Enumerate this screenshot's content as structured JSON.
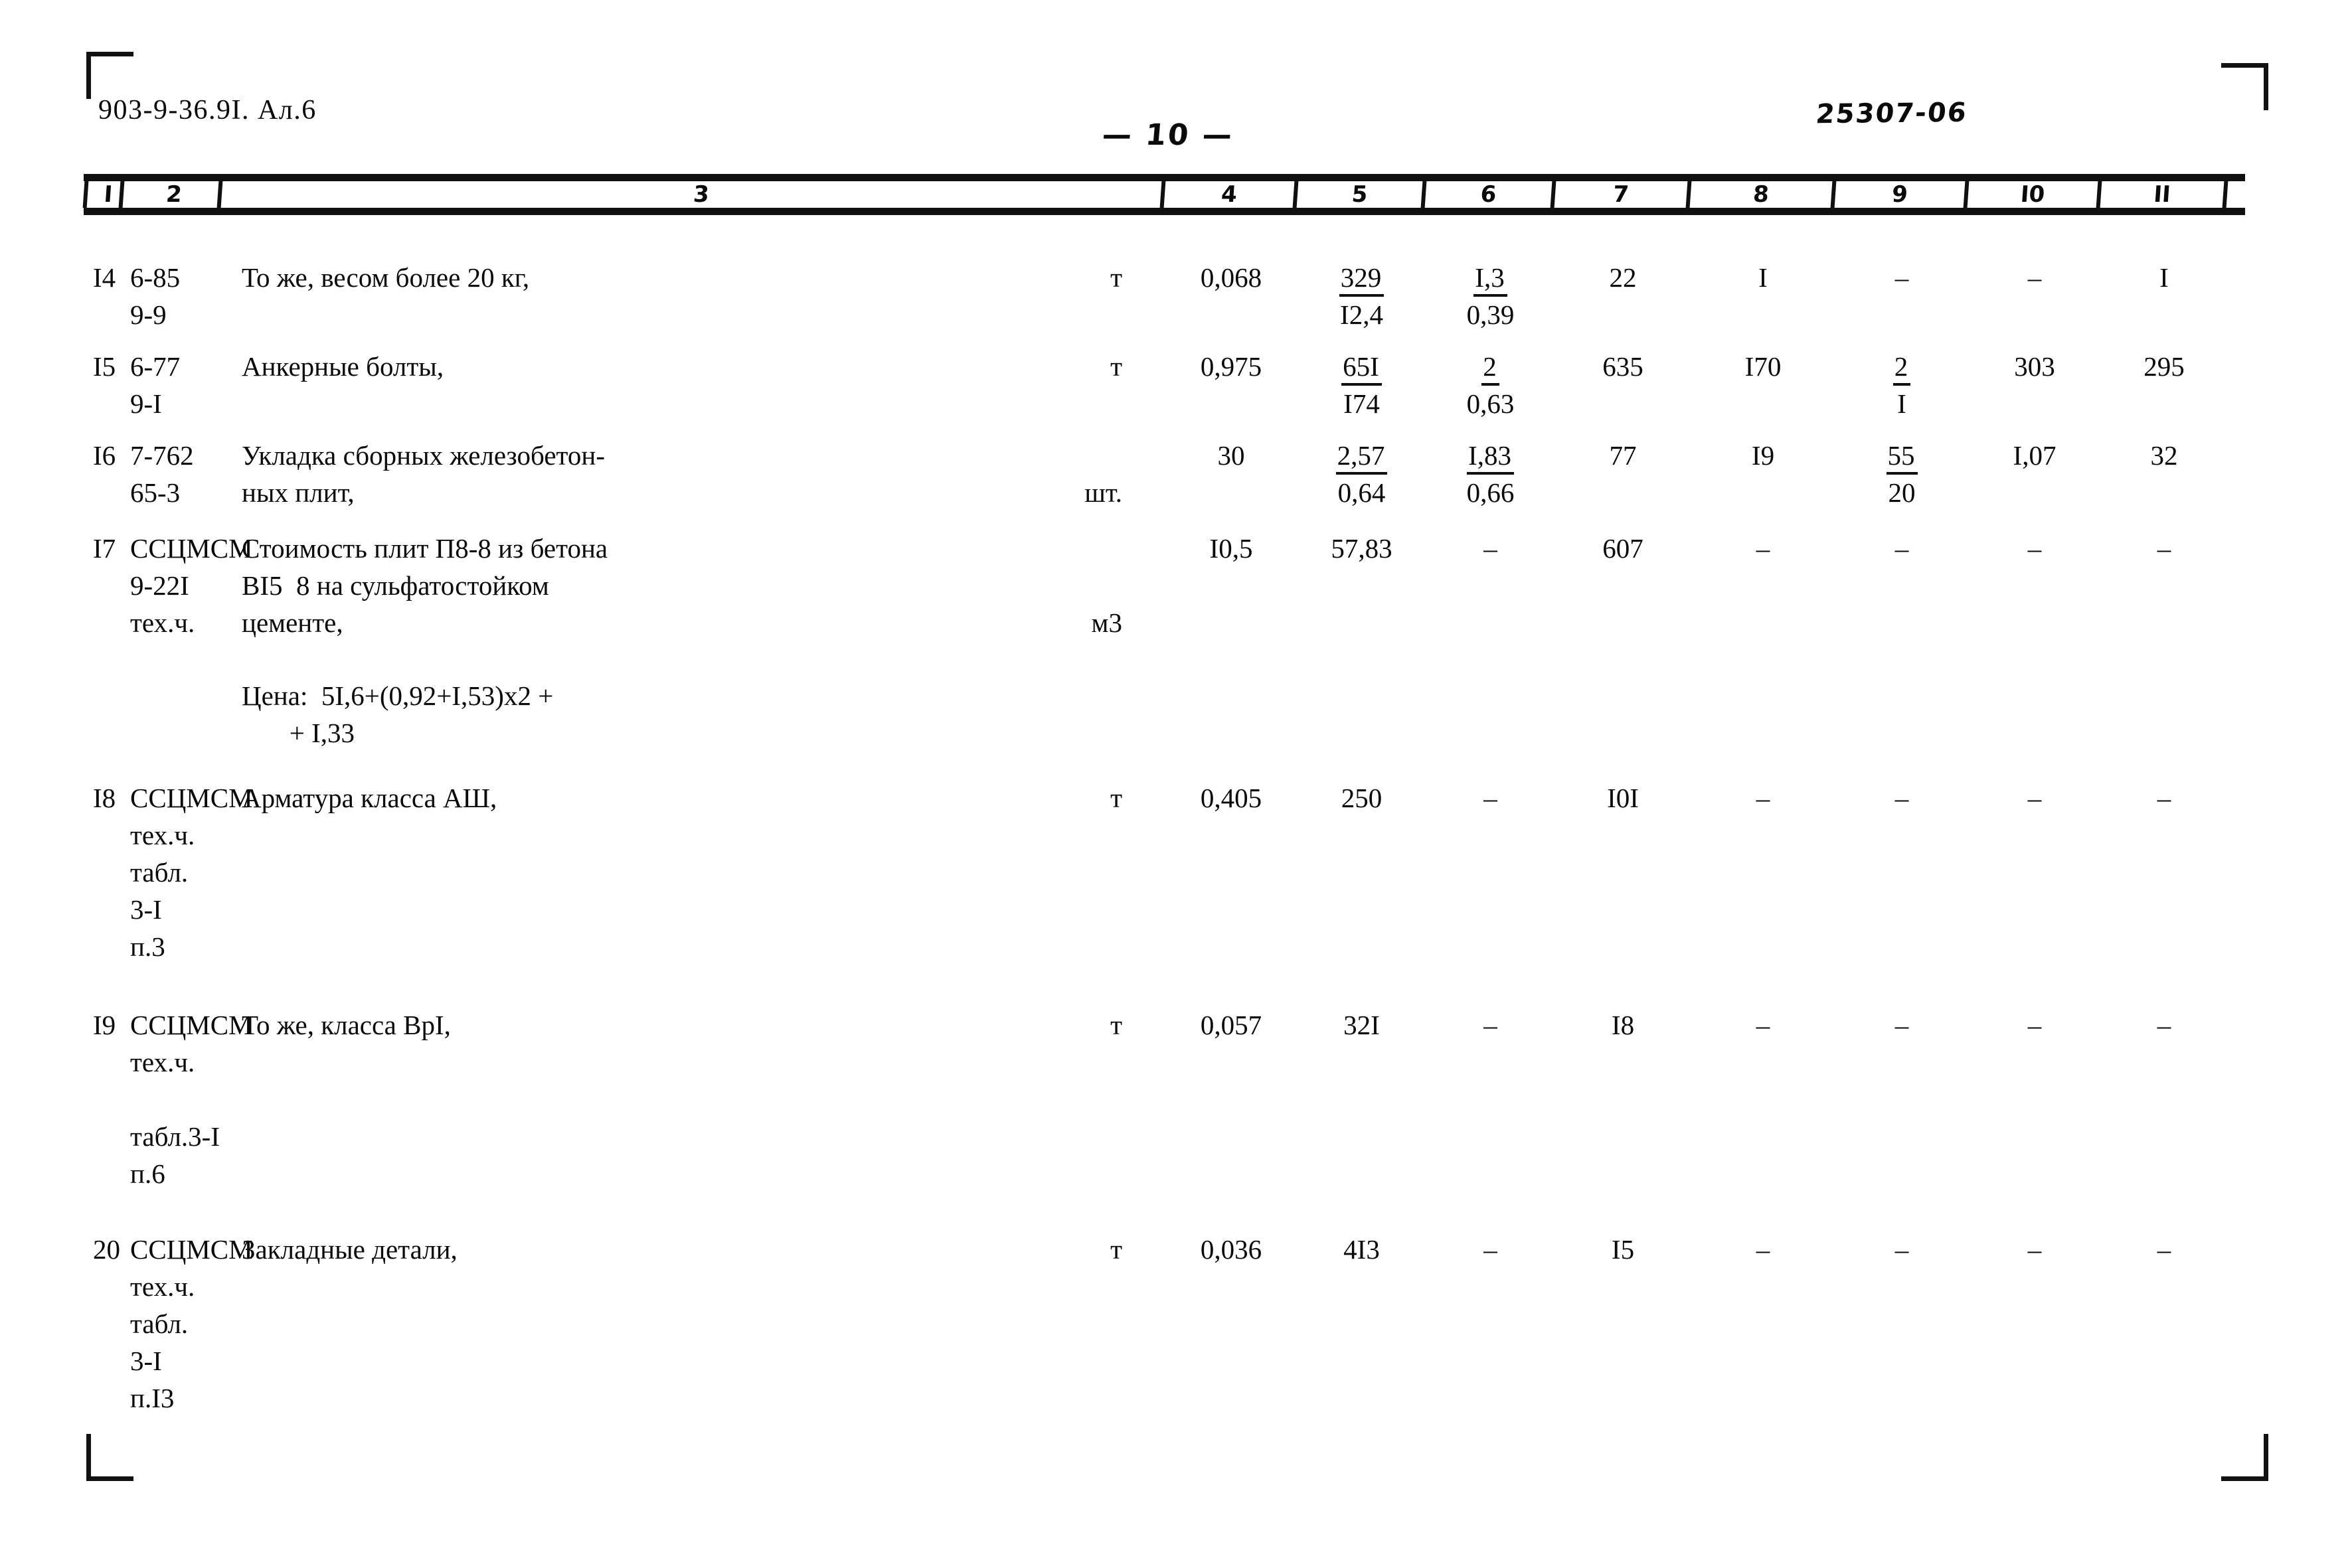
{
  "header": {
    "doc_code": "903-9-36.9I. Ал.6",
    "page_number": "— 10 —",
    "stamp_code": "25307-06"
  },
  "table": {
    "column_headers": [
      "I",
      "2",
      "3",
      "4",
      "5",
      "6",
      "7",
      "8",
      "9",
      "I0",
      "II"
    ],
    "rows": [
      {
        "c1": "I4",
        "c2": "6-85\n9-9",
        "c3": "То же, весом более 20 кг,",
        "unit": "т",
        "c4": "0,068",
        "c5_top": "329",
        "c5_bot": "I2,4",
        "c6_top": "I,3",
        "c6_bot": "0,39",
        "c7": "22",
        "c8": "I",
        "c9_top": "–",
        "c9_bot": "",
        "c10": "–",
        "c11": "I"
      },
      {
        "c1": "I5",
        "c2": "6-77\n9-I",
        "c3": "Анкерные болты,",
        "unit": "т",
        "c4": "0,975",
        "c5_top": "65I",
        "c5_bot": "I74",
        "c6_top": "2",
        "c6_bot": "0,63",
        "c7": "635",
        "c8": "I70",
        "c9_top": "2",
        "c9_bot": "I",
        "c10": "303",
        "c11": "295"
      },
      {
        "c1": "I6",
        "c2": "7-762\n65-3",
        "c3": "Укладка сборных железобетон-\nных плит,",
        "unit": "шт.",
        "c4": "30",
        "c5_top": "2,57",
        "c5_bot": "0,64",
        "c6_top": "I,83",
        "c6_bot": "0,66",
        "c7": "77",
        "c8": "I9",
        "c9_top": "55",
        "c9_bot": "20",
        "c10": "I,07",
        "c11": "32"
      },
      {
        "c1": "I7",
        "c2": "ССЦМСМ\n9-22I\nтех.ч.",
        "c3": "Стоимость плит П8-8 из бетона\nВI5  8 на сульфатостойком\nцементе,",
        "unit": "м3",
        "c4": "I0,5",
        "c5_top": "57,83",
        "c5_bot": "",
        "c6_top": "–",
        "c6_bot": "",
        "c7": "607",
        "c8": "–",
        "c9_top": "–",
        "c9_bot": "",
        "c10": "–",
        "c11": "–",
        "note": "Цена:  5I,6+(0,92+I,53)х2 +\n       + I,33"
      },
      {
        "c1": "I8",
        "c2": "ССЦМСМ\nтех.ч.\nтабл.\n3-I\nп.3",
        "c3": "Арматура класса АШ,",
        "unit": "т",
        "c4": "0,405",
        "c5_top": "250",
        "c5_bot": "",
        "c6_top": "–",
        "c6_bot": "",
        "c7": "I0I",
        "c8": "–",
        "c9_top": "–",
        "c9_bot": "",
        "c10": "–",
        "c11": "–"
      },
      {
        "c1": "I9",
        "c2": "ССЦМСМ\nтех.ч.\n\nтабл.3-I\nп.6",
        "c3": "То же, класса ВрI,",
        "unit": "т",
        "c4": "0,057",
        "c5_top": "32I",
        "c5_bot": "",
        "c6_top": "–",
        "c6_bot": "",
        "c7": "I8",
        "c8": "–",
        "c9_top": "–",
        "c9_bot": "",
        "c10": "–",
        "c11": "–"
      },
      {
        "c1": "20",
        "c2": "ССЦМСМ\nтех.ч.\nтабл.\n3-I\nп.I3",
        "c3": "Закладные детали,",
        "unit": "т",
        "c4": "0,036",
        "c5_top": "4I3",
        "c5_bot": "",
        "c6_top": "–",
        "c6_bot": "",
        "c7": "I5",
        "c8": "–",
        "c9_top": "–",
        "c9_bot": "",
        "c10": "–",
        "c11": "–"
      }
    ]
  }
}
